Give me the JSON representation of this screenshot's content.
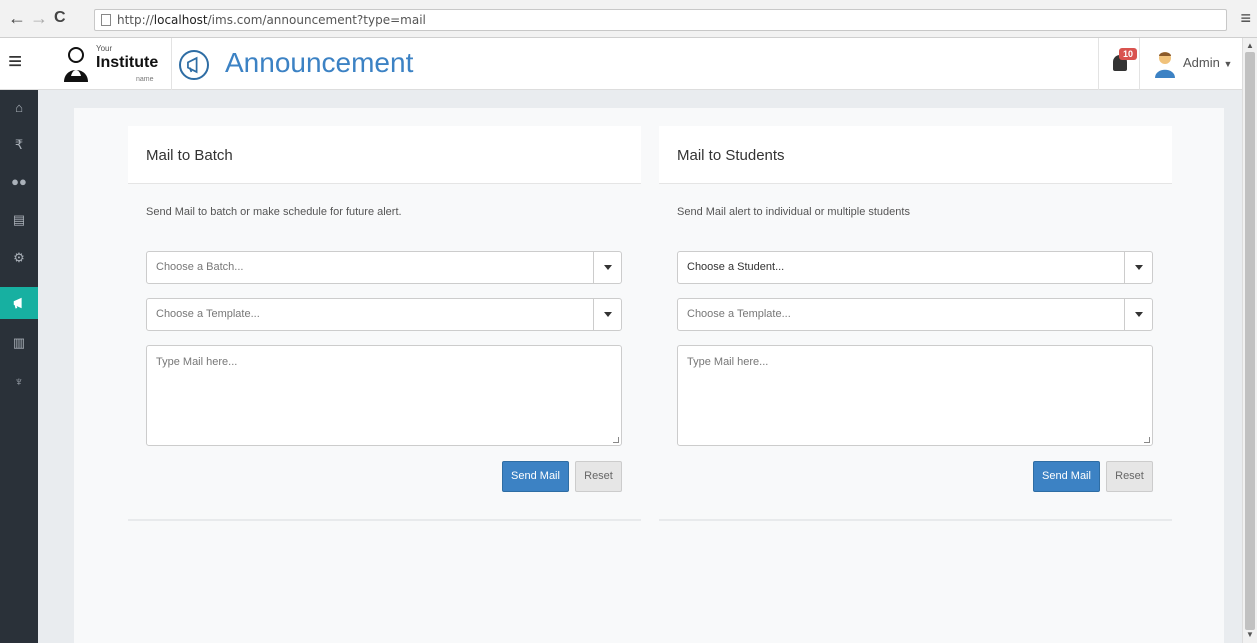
{
  "browser": {
    "url_prefix": "http://",
    "url_host": "localhost",
    "url_path": "/ims.com/announcement?type=mail"
  },
  "header": {
    "logo_small": "Your",
    "logo_text": "Institute",
    "logo_name": "name",
    "title": "Announcement",
    "notification_count": "10",
    "user_label": "Admin"
  },
  "icons": {
    "sidebar": [
      "home-icon",
      "rupee-icon",
      "users-icon",
      "file-icon",
      "settings-icon",
      "bullhorn-icon",
      "chart-icon",
      "trophy-icon"
    ],
    "active": "bullhorn-icon"
  },
  "colors": {
    "accent": "#3c82c4",
    "sidebar": "#2a3139",
    "sidebar_active": "#17b0a1",
    "badge": "#d9534f"
  },
  "panels": {
    "batch": {
      "title": "Mail to Batch",
      "description": "Send Mail to batch or make schedule for future alert.",
      "select1_placeholder": "Choose a Batch...",
      "select2_placeholder": "Choose a Template...",
      "textarea_placeholder": "Type Mail here...",
      "send_label": "Send Mail",
      "reset_label": "Reset"
    },
    "students": {
      "title": "Mail to Students",
      "description": "Send Mail alert to individual or multiple students",
      "select1_value": "Choose a Student...",
      "select2_placeholder": "Choose a Template...",
      "textarea_placeholder": "Type Mail here...",
      "send_label": "Send Mail",
      "reset_label": "Reset"
    }
  }
}
